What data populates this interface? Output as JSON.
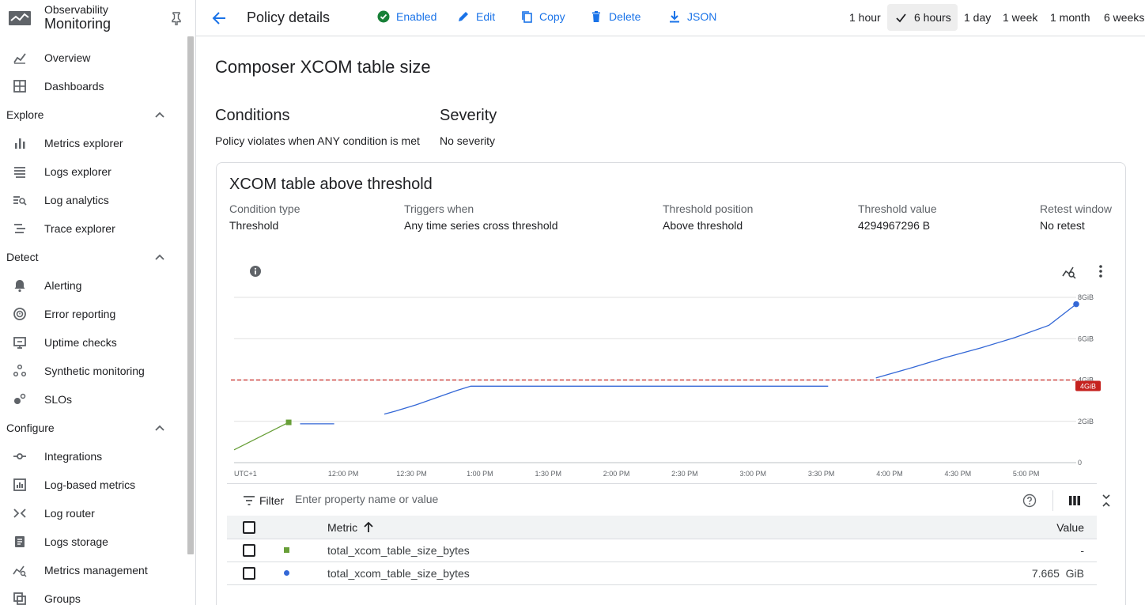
{
  "app": {
    "subtitle": "Observability",
    "title": "Monitoring"
  },
  "sidebar": {
    "top_items": [
      {
        "label": "Overview",
        "icon": "overview-icon"
      },
      {
        "label": "Dashboards",
        "icon": "dashboards-icon"
      }
    ],
    "sections": [
      {
        "label": "Explore",
        "items": [
          {
            "label": "Metrics explorer",
            "icon": "bar-chart-icon"
          },
          {
            "label": "Logs explorer",
            "icon": "logs-icon"
          },
          {
            "label": "Log analytics",
            "icon": "log-analytics-icon"
          },
          {
            "label": "Trace explorer",
            "icon": "trace-icon"
          }
        ]
      },
      {
        "label": "Detect",
        "items": [
          {
            "label": "Alerting",
            "icon": "bell-icon"
          },
          {
            "label": "Error reporting",
            "icon": "error-icon"
          },
          {
            "label": "Uptime checks",
            "icon": "monitor-icon"
          },
          {
            "label": "Synthetic monitoring",
            "icon": "synthetic-icon"
          },
          {
            "label": "SLOs",
            "icon": "slo-icon"
          }
        ]
      },
      {
        "label": "Configure",
        "items": [
          {
            "label": "Integrations",
            "icon": "integrations-icon"
          },
          {
            "label": "Log-based metrics",
            "icon": "log-metrics-icon"
          },
          {
            "label": "Log router",
            "icon": "router-icon"
          },
          {
            "label": "Logs storage",
            "icon": "storage-icon"
          },
          {
            "label": "Metrics management",
            "icon": "metrics-management-icon"
          },
          {
            "label": "Groups",
            "icon": "groups-icon"
          }
        ]
      }
    ]
  },
  "header": {
    "title": "Policy details",
    "actions": {
      "enabled": "Enabled",
      "edit": "Edit",
      "copy": "Copy",
      "delete": "Delete",
      "json": "JSON"
    },
    "time_ranges": [
      "1 hour",
      "6 hours",
      "1 day",
      "1 week",
      "1 month",
      "6 weeks"
    ],
    "selected_range": "6 hours"
  },
  "policy": {
    "name": "Composer XCOM table size",
    "conditions_heading": "Conditions",
    "conditions_text": "Policy violates when ANY condition is met",
    "severity_heading": "Severity",
    "severity_text": "No severity"
  },
  "condition": {
    "title": "XCOM table above threshold",
    "fields": {
      "type_label": "Condition type",
      "type_value": "Threshold",
      "triggers_label": "Triggers when",
      "triggers_value": "Any time series cross threshold",
      "position_label": "Threshold position",
      "position_value": "Above threshold",
      "value_label": "Threshold value",
      "value_value": "4294967296 B",
      "retest_label": "Retest window",
      "retest_value": "No retest"
    }
  },
  "chart_data": {
    "type": "line",
    "x_tick_labels": [
      "UTC+1",
      "12:00 PM",
      "12:30 PM",
      "1:00 PM",
      "1:30 PM",
      "2:00 PM",
      "2:30 PM",
      "3:00 PM",
      "3:30 PM",
      "4:00 PM",
      "4:30 PM",
      "5:00 PM"
    ],
    "x_tick_minutes": [
      null,
      720,
      750,
      780,
      810,
      840,
      870,
      900,
      930,
      960,
      990,
      1020
    ],
    "xlim_minutes": [
      672,
      1042
    ],
    "y_tick_labels": [
      "0",
      "2GiB",
      "4GiB",
      "6GiB",
      "8GiB"
    ],
    "ylim_gib": [
      0,
      8
    ],
    "threshold": {
      "value_gib": 4,
      "label": "4GiB",
      "color": "#c5221f"
    },
    "series": [
      {
        "color": "#689f38",
        "marker": "square",
        "segments": [
          [
            [
              672,
              0.62
            ],
            [
              696,
              1.95
            ]
          ]
        ]
      },
      {
        "color": "#3367d6",
        "marker": "circle",
        "segments": [
          [
            [
              701,
              1.88
            ],
            [
              716,
              1.88
            ]
          ],
          [
            [
              738,
              2.35
            ],
            [
              743,
              2.5
            ],
            [
              752,
              2.8
            ],
            [
              761,
              3.15
            ],
            [
              770,
              3.5
            ],
            [
              776,
              3.7
            ],
            [
              792,
              3.7
            ],
            [
              820,
              3.7
            ],
            [
              850,
              3.7
            ],
            [
              880,
              3.7
            ],
            [
              910,
              3.7
            ],
            [
              933,
              3.7
            ]
          ],
          [
            [
              954,
              4.1
            ],
            [
              970,
              4.6
            ],
            [
              985,
              5.1
            ],
            [
              1000,
              5.55
            ],
            [
              1015,
              6.05
            ],
            [
              1030,
              6.65
            ],
            [
              1042,
              7.67
            ]
          ]
        ]
      }
    ]
  },
  "filter": {
    "label": "Filter",
    "placeholder": "Enter property name or value"
  },
  "table": {
    "columns": {
      "metric": "Metric",
      "value": "Value"
    },
    "rows": [
      {
        "metric": "total_xcom_table_size_bytes",
        "value": "-",
        "marker": "square",
        "color": "#689f38"
      },
      {
        "metric": "total_xcom_table_size_bytes",
        "value": "7.665  GiB",
        "marker": "circle",
        "color": "#3367d6"
      }
    ]
  },
  "colors": {
    "accent": "#1a73e8",
    "enabled": "#188038",
    "threshold": "#c5221f"
  }
}
